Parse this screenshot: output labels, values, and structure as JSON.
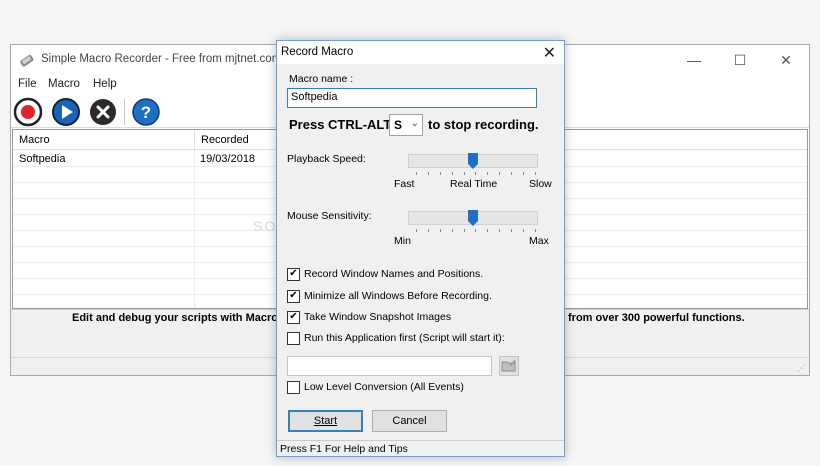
{
  "main_window": {
    "title": "Simple Macro Recorder - Free from mjtnet.com",
    "menu": [
      "File",
      "Macro",
      "Help"
    ],
    "toolbar_icons": [
      "record-icon",
      "play-icon",
      "stop-icon",
      "help-icon"
    ],
    "list": {
      "columns": [
        "Macro",
        "Recorded"
      ],
      "rows": [
        {
          "macro": "Softpedia",
          "recorded": "19/03/2018"
        }
      ]
    },
    "info_text_left": "Edit and debug your scripts with Macro",
    "info_text_right": "from over 300 powerful functions.",
    "watermark": "SOFTPEDIA"
  },
  "dialog": {
    "title": "Record Macro",
    "macro_name_label": "Macro name :",
    "macro_name_value": "Softpedia",
    "press_prefix": "Press CTRL-ALT-",
    "stop_key": "S",
    "press_suffix": "to stop recording.",
    "playback_label": "Playback Speed:",
    "playback_ticks": [
      "Fast",
      "Real Time",
      "Slow"
    ],
    "playback_level": 0.5,
    "mouse_label": "Mouse Sensitivity:",
    "mouse_ticks": [
      "Min",
      "Max"
    ],
    "mouse_level": 0.5,
    "checkboxes": [
      {
        "label": "Record Window Names and Positions.",
        "checked": true
      },
      {
        "label": "Minimize all Windows Before Recording.",
        "checked": true
      },
      {
        "label": "Take Window Snapshot Images",
        "checked": true
      },
      {
        "label": "Run this Application first (Script will start it):",
        "checked": false
      }
    ],
    "low_level_label": "Low Level Conversion (All Events)",
    "low_level_checked": false,
    "start_label": "Start",
    "cancel_label": "Cancel",
    "status": "Press F1 For Help and Tips"
  },
  "colors": {
    "accent_blue": "#3c7fb1",
    "record_red": "#d9252b",
    "play_blue": "#1a64b8",
    "slider_thumb": "#1f6fc2"
  }
}
